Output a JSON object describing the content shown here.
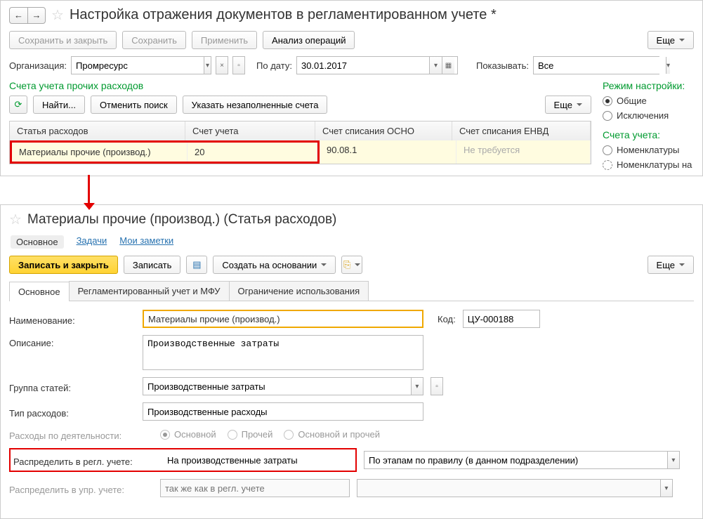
{
  "top": {
    "title": "Настройка отражения документов в регламентированном учете *",
    "btns": {
      "save_close": "Сохранить и закрыть",
      "save": "Сохранить",
      "apply": "Применить",
      "analyze": "Анализ операций",
      "more": "Еще"
    },
    "org_label": "Организация:",
    "org_value": "Промресурс",
    "date_label": "По дату:",
    "date_value": "30.01.2017",
    "show_label": "Показывать:",
    "show_value": "Все",
    "section": "Счета учета прочих расходов",
    "tb": {
      "find": "Найти...",
      "cancel": "Отменить поиск",
      "specify": "Указать незаполненные счета",
      "more": "Еще"
    },
    "headers": {
      "c1": "Статья расходов",
      "c2": "Счет учета",
      "c3": "Счет списания ОСНО",
      "c4": "Счет списания ЕНВД"
    },
    "row": {
      "c1": "Материалы прочие (производ.)",
      "c2": "20",
      "c3": "90.08.1",
      "c4": "Не требуется"
    },
    "mode_title": "Режим настройки:",
    "modes": {
      "general": "Общие",
      "exceptions": "Исключения"
    },
    "accounts_title": "Счета учета:",
    "accounts": {
      "nomen": "Номенклатуры",
      "nomen_on": "Номенклатуры на"
    }
  },
  "bottom": {
    "title": "Материалы прочие (производ.) (Статья расходов)",
    "links": {
      "main": "Основное",
      "tasks": "Задачи",
      "notes": "Мои заметки"
    },
    "tb": {
      "save_close": "Записать и закрыть",
      "save": "Записать",
      "create": "Создать на основании",
      "more": "Еще"
    },
    "tabs": {
      "main": "Основное",
      "regl": "Регламентированный учет и МФУ",
      "restrict": "Ограничение использования"
    },
    "form": {
      "name_label": "Наименование:",
      "name_value": "Материалы прочие (производ.)",
      "code_label": "Код:",
      "code_value": "ЦУ-000188",
      "desc_label": "Описание:",
      "desc_value": "Производственные затраты",
      "group_label": "Группа статей:",
      "group_value": "Производственные затраты",
      "type_label": "Тип расходов:",
      "type_value": "Производственные расходы",
      "activity_label": "Расходы по деятельности:",
      "activity": {
        "main": "Основной",
        "other": "Прочей",
        "both": "Основной и прочей"
      },
      "dist_regl_label": "Распределить в регл. учете:",
      "dist_regl_value": "На производственные затраты",
      "dist_rule_value": "По этапам по правилу (в данном подразделении)",
      "dist_upr_label": "Распределить в упр. учете:",
      "dist_upr_placeholder": "так же как в регл. учете"
    }
  }
}
